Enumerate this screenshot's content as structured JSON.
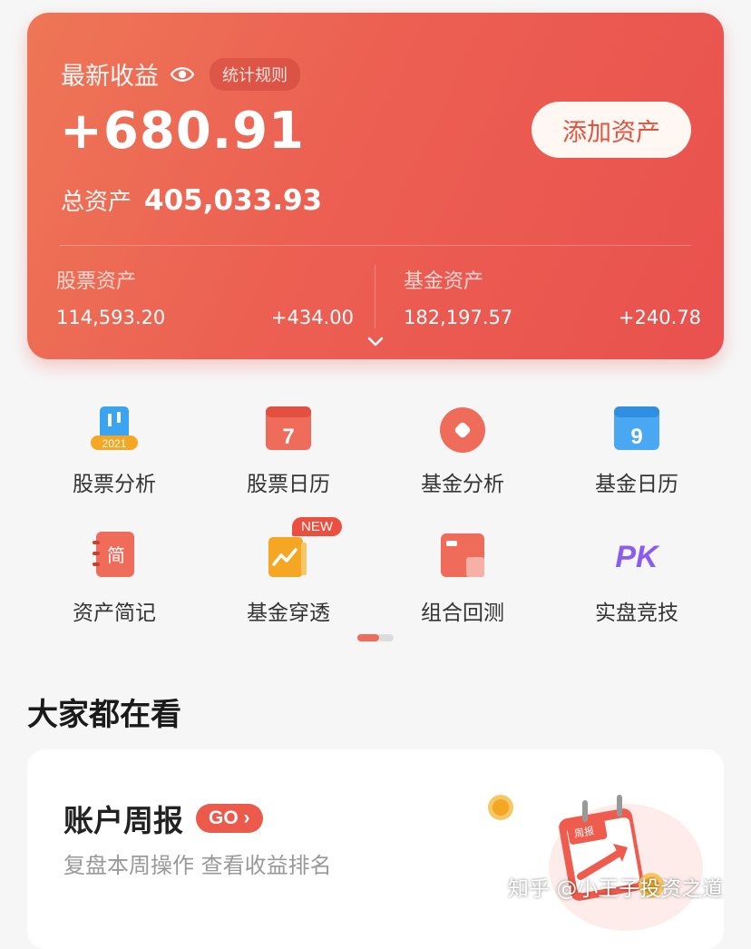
{
  "summary": {
    "title": "最新收益",
    "rule_chip": "统计规则",
    "profit": "+680.91",
    "add_button": "添加资产",
    "total_label": "总资产",
    "total_value": "405,033.93",
    "stock": {
      "label": "股票资产",
      "amount": "114,593.20",
      "change": "+434.00"
    },
    "fund": {
      "label": "基金资产",
      "amount": "182,197.57",
      "change": "+240.78"
    }
  },
  "tools": [
    {
      "label": "股票分析",
      "icon": "stock-analysis-icon",
      "icon_text": "2021"
    },
    {
      "label": "股票日历",
      "icon": "stock-calendar-icon",
      "icon_text": "7"
    },
    {
      "label": "基金分析",
      "icon": "fund-analysis-icon"
    },
    {
      "label": "基金日历",
      "icon": "fund-calendar-icon",
      "icon_text": "9"
    },
    {
      "label": "资产简记",
      "icon": "asset-notes-icon",
      "icon_text": "简"
    },
    {
      "label": "基金穿透",
      "icon": "fund-penetration-icon",
      "badge": "NEW"
    },
    {
      "label": "组合回测",
      "icon": "portfolio-backtest-icon"
    },
    {
      "label": "实盘竞技",
      "icon": "pk-icon",
      "icon_text": "PK"
    }
  ],
  "pager": {
    "pages": 2,
    "active": 1
  },
  "section": {
    "title": "大家都在看"
  },
  "weekly": {
    "title": "账户周报",
    "go": "GO",
    "subtitle": "复盘本周操作 查看收益排名",
    "illus_text": "周报"
  },
  "watermark": "知乎 @小王子投资之道",
  "colors": {
    "accent": "#ec5f52",
    "brand_red": "#e9514e",
    "pk_purple": "#8a5cf0"
  }
}
